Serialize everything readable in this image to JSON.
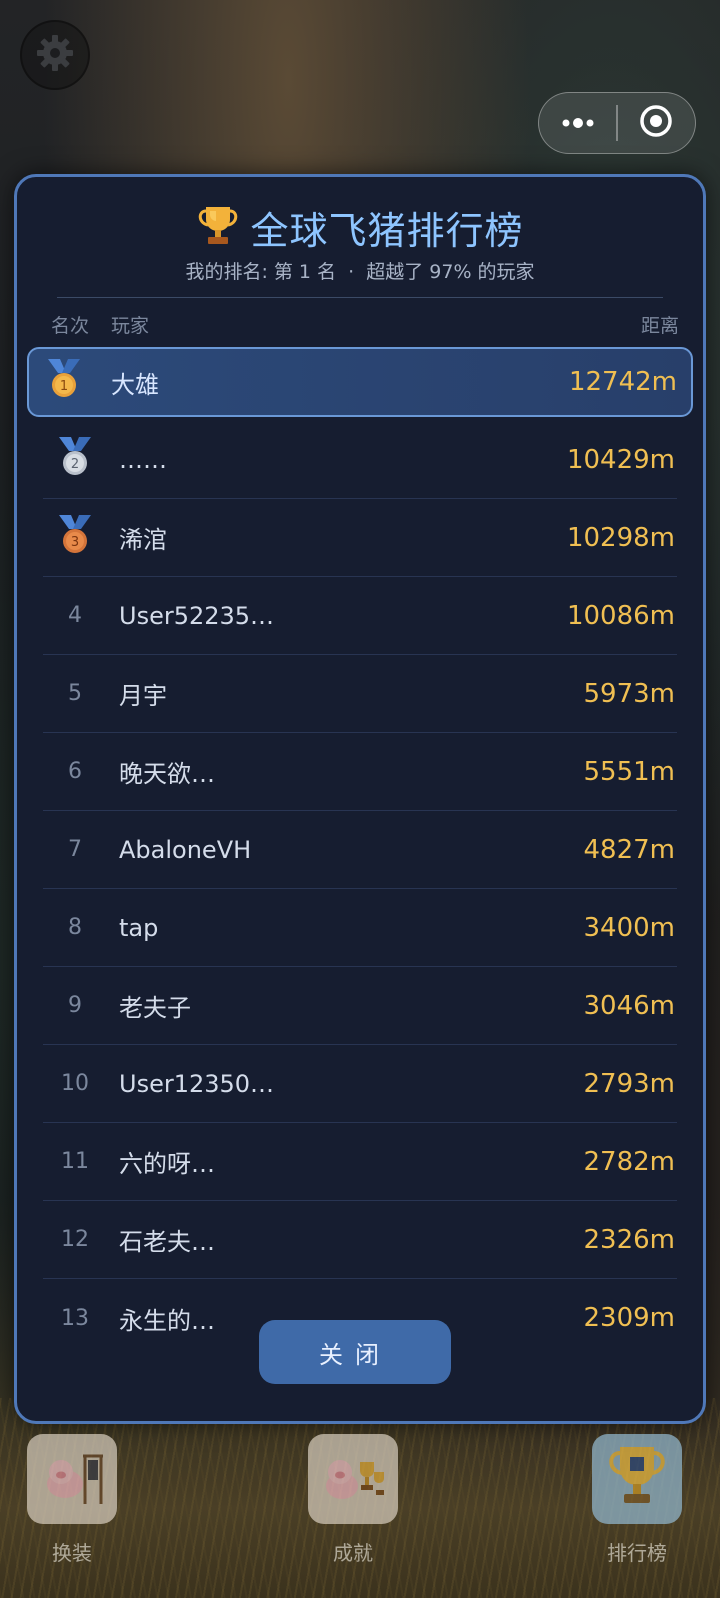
{
  "leaderboard": {
    "title": "全球飞猪排行榜",
    "subtitle": "我的排名: 第 1 名  ·  超越了 97% 的玩家",
    "headers": {
      "rank": "名次",
      "player": "玩家",
      "distance": "距离"
    },
    "rows": [
      {
        "rank": "1",
        "name": "大雄",
        "distance": "12742m",
        "medal": "gold"
      },
      {
        "rank": "2",
        "name": "……",
        "distance": "10429m",
        "medal": "silver"
      },
      {
        "rank": "3",
        "name": "浠涫",
        "distance": "10298m",
        "medal": "bronze"
      },
      {
        "rank": "4",
        "name": "User52235…",
        "distance": "10086m"
      },
      {
        "rank": "5",
        "name": "月宇",
        "distance": "5973m"
      },
      {
        "rank": "6",
        "name": "晚天欲…",
        "distance": "5551m"
      },
      {
        "rank": "7",
        "name": "AbaloneVH",
        "distance": "4827m"
      },
      {
        "rank": "8",
        "name": "tap",
        "distance": "3400m"
      },
      {
        "rank": "9",
        "name": "老夫子",
        "distance": "3046m"
      },
      {
        "rank": "10",
        "name": "User12350…",
        "distance": "2793m"
      },
      {
        "rank": "11",
        "name": "六的呀…",
        "distance": "2782m"
      },
      {
        "rank": "12",
        "name": "石老夫…",
        "distance": "2326m"
      },
      {
        "rank": "13",
        "name": "永生的…",
        "distance": "2309m"
      }
    ],
    "close_label": "关闭"
  },
  "tabs": [
    {
      "label": "换装",
      "icon": "pig-wardrobe-icon"
    },
    {
      "label": "成就",
      "icon": "pig-trophies-icon"
    },
    {
      "label": "排行榜",
      "icon": "trophy-cup-icon"
    }
  ],
  "colors": {
    "panel_bg": "#161d30",
    "panel_border": "#4f78b8",
    "title": "#8ec5ff",
    "distance": "#f0bf52",
    "highlight_row": "#2c4a7a",
    "close_button": "#3f6aa8"
  }
}
